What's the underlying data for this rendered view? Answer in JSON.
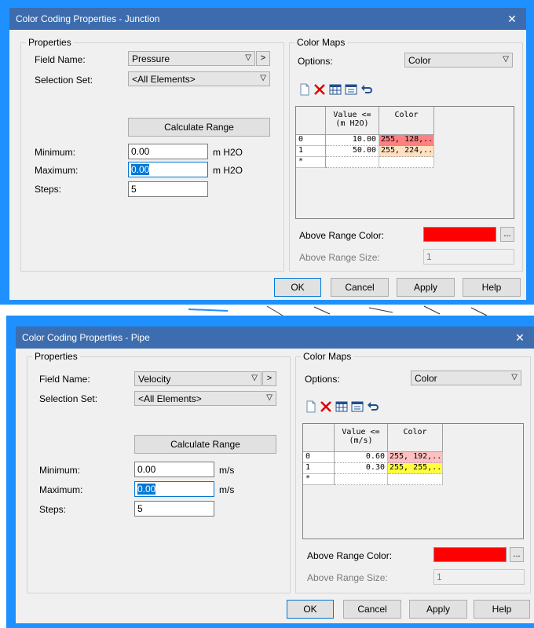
{
  "dialogs": [
    {
      "title": "Color Coding Properties - Junction",
      "close_glyph": "✕",
      "properties": {
        "legend": "Properties",
        "field_name_label": "Field Name:",
        "field_name_value": "Pressure",
        "more_glyph": ">",
        "selection_set_label": "Selection Set:",
        "selection_set_value": "<All Elements>",
        "calculate_range_label": "Calculate Range",
        "minimum_label": "Minimum:",
        "minimum_value": "0.00",
        "minimum_unit": "m H2O",
        "maximum_label": "Maximum:",
        "maximum_value": "0.00",
        "maximum_unit": "m H2O",
        "steps_label": "Steps:",
        "steps_value": "5"
      },
      "color_maps": {
        "legend": "Color Maps",
        "options_label": "Options:",
        "options_value": "Color",
        "toolbar_icons": [
          "new-icon",
          "delete-icon",
          "grid-icon",
          "table-icon",
          "undo-icon"
        ],
        "table": {
          "value_header_line1": "Value <=",
          "value_header_line2": "(m H2O)",
          "color_header": "Color",
          "rows": [
            {
              "index": "0",
              "value": "10.00",
              "color_text": "255, 128,...",
              "color_hex": "#ff8080"
            },
            {
              "index": "1",
              "value": "50.00",
              "color_text": "255, 224,...",
              "color_hex": "#ffe0c0"
            }
          ],
          "new_row_marker": "*"
        },
        "above_range_color_label": "Above Range Color:",
        "above_range_color_hex": "#ff0000",
        "ellipsis": "...",
        "above_range_size_label": "Above Range Size:",
        "above_range_size_value": "1"
      },
      "buttons": {
        "ok": "OK",
        "cancel": "Cancel",
        "apply": "Apply",
        "help": "Help"
      },
      "titlebar_color": "#3c6cad"
    },
    {
      "title": "Color Coding Properties - Pipe",
      "close_glyph": "✕",
      "properties": {
        "legend": "Properties",
        "field_name_label": "Field Name:",
        "field_name_value": "Velocity",
        "more_glyph": ">",
        "selection_set_label": "Selection Set:",
        "selection_set_value": "<All Elements>",
        "calculate_range_label": "Calculate Range",
        "minimum_label": "Minimum:",
        "minimum_value": "0.00",
        "minimum_unit": "m/s",
        "maximum_label": "Maximum:",
        "maximum_value": "0.00",
        "maximum_unit": "m/s",
        "steps_label": "Steps:",
        "steps_value": "5"
      },
      "color_maps": {
        "legend": "Color Maps",
        "options_label": "Options:",
        "options_value": "Color",
        "toolbar_icons": [
          "new-icon",
          "delete-icon",
          "grid-icon",
          "table-icon",
          "undo-icon"
        ],
        "table": {
          "value_header_line1": "Value <=",
          "value_header_line2": "(m/s)",
          "color_header": "Color",
          "rows": [
            {
              "index": "0",
              "value": "0.60",
              "color_text": "255, 192,...",
              "color_hex": "#ffc0c0"
            },
            {
              "index": "1",
              "value": "0.30",
              "color_text": "255, 255,...",
              "color_hex": "#ffff40"
            }
          ],
          "new_row_marker": "*"
        },
        "above_range_color_label": "Above Range Color:",
        "above_range_color_hex": "#ff0000",
        "ellipsis": "...",
        "above_range_size_label": "Above Range Size:",
        "above_range_size_value": "1"
      },
      "buttons": {
        "ok": "OK",
        "cancel": "Cancel",
        "apply": "Apply",
        "help": "Help"
      },
      "titlebar_color": "#3d6dae"
    }
  ],
  "frame_color": "#1e90ff"
}
